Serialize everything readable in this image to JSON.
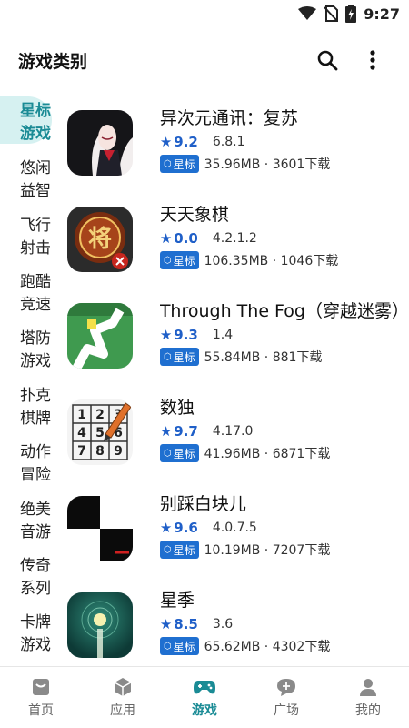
{
  "status": {
    "time": "9:27"
  },
  "header": {
    "title": "游戏类别"
  },
  "sidebar": {
    "items": [
      {
        "label": "星标游戏"
      },
      {
        "label": "悠闲益智"
      },
      {
        "label": "飞行射击"
      },
      {
        "label": "跑酷竞速"
      },
      {
        "label": "塔防游戏"
      },
      {
        "label": "扑克棋牌"
      },
      {
        "label": "动作冒险"
      },
      {
        "label": "绝美音游"
      },
      {
        "label": "传奇系列"
      },
      {
        "label": "卡牌游戏"
      }
    ]
  },
  "games": [
    {
      "name": "异次元通讯：复苏",
      "rating": "9.2",
      "version": "6.8.1",
      "badge": "星标",
      "stats": "35.96MB · 3601下载"
    },
    {
      "name": "天天象棋",
      "rating": "0.0",
      "version": "4.2.1.2",
      "badge": "星标",
      "stats": "106.35MB · 1046下载"
    },
    {
      "name": "Through The Fog（穿越迷雾）",
      "rating": "9.3",
      "version": "1.4",
      "badge": "星标",
      "stats": "55.84MB · 881下载"
    },
    {
      "name": "数独",
      "rating": "9.7",
      "version": "4.17.0",
      "badge": "星标",
      "stats": "41.96MB · 6871下载"
    },
    {
      "name": "别踩白块儿",
      "rating": "9.6",
      "version": "4.0.7.5",
      "badge": "星标",
      "stats": "10.19MB · 7207下载"
    },
    {
      "name": "星季",
      "rating": "8.5",
      "version": "3.6",
      "badge": "星标",
      "stats": "65.62MB · 4302下载"
    }
  ],
  "icon_texts": {
    "chess_piece": "将",
    "sudoku": [
      "1",
      "2",
      "3",
      "4",
      "5",
      "6",
      "7",
      "8",
      "9"
    ]
  },
  "tabs": [
    {
      "label": "首页"
    },
    {
      "label": "应用"
    },
    {
      "label": "游戏"
    },
    {
      "label": "广场"
    },
    {
      "label": "我的"
    }
  ],
  "colors": {
    "accent": "#1a8b95",
    "rating_blue": "#1f5fc8",
    "badge_blue": "#1f6fd0",
    "active_bg": "#d6f1f1"
  }
}
